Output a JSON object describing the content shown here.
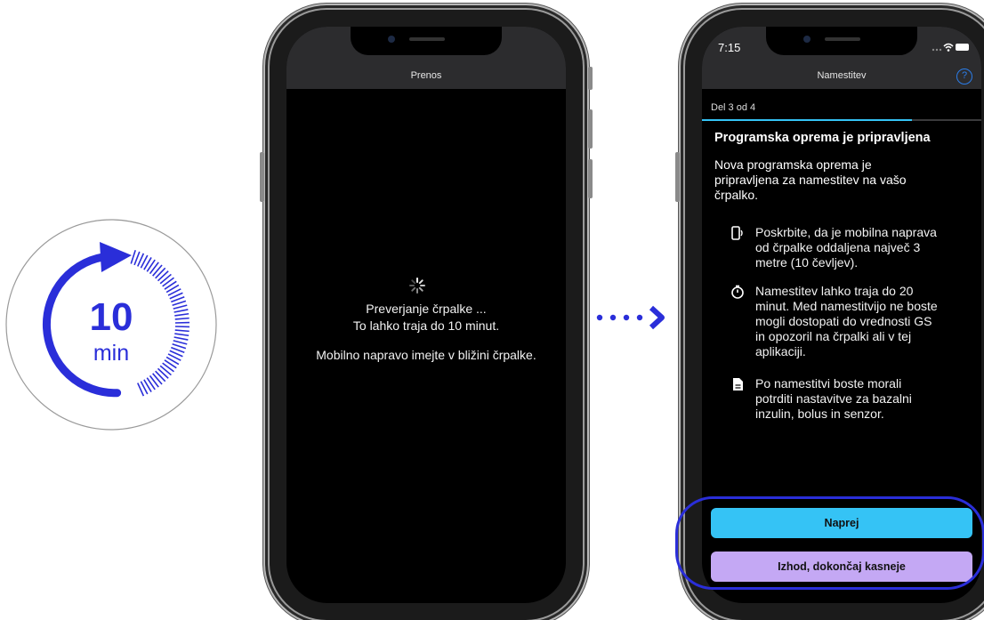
{
  "timer": {
    "value": "10",
    "unit": "min"
  },
  "left_phone": {
    "title": "Prenos",
    "message_line1": "Preverjanje črpalke ...",
    "message_line2": "To lahko traja do 10 minut.",
    "message_line3": "Mobilno napravo imejte v bližini črpalke."
  },
  "right_phone": {
    "status_time": "7:15",
    "title": "Namestitev",
    "help_icon": "?",
    "step": "Del 3 od 4",
    "progress_fraction": 0.75,
    "heading": "Programska oprema je pripravljena",
    "intro": "Nova programska oprema je pripravljena za namestitev na vašo črpalko.",
    "items": [
      {
        "icon": "mobile-signal-icon",
        "text": "Poskrbite, da je mobilna naprava od črpalke oddaljena največ 3 metre (10 čevljev)."
      },
      {
        "icon": "stopwatch-icon",
        "text": "Namestitev lahko traja do 20 minut. Med namestitvijo ne boste mogli dostopati do vrednosti GS in opozoril na črpalki ali v tej aplikaciji."
      },
      {
        "icon": "document-icon",
        "text": "Po namestitvi boste morali potrditi nastavitve za bazalni inzulin, bolus in senzor."
      }
    ],
    "next_button": "Naprej",
    "exit_button": "Izhod, dokončaj kasneje"
  },
  "colors": {
    "accent_blue": "#2a2ed9",
    "button_cyan": "#35c3f5",
    "button_lavender": "#c4a8f4",
    "progress": "#35c3f5"
  }
}
